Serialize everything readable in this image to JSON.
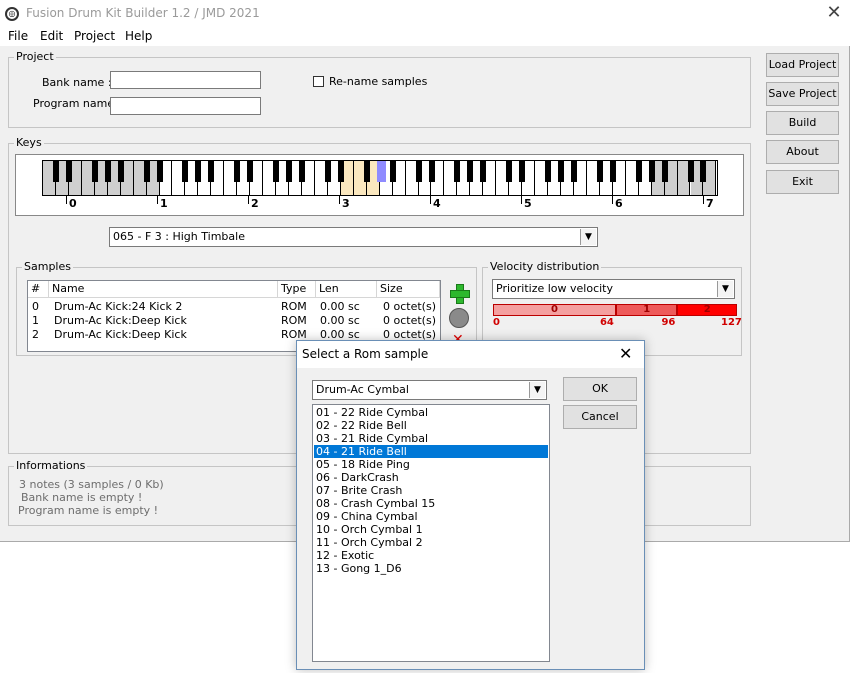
{
  "window": {
    "title": "Fusion Drum Kit Builder 1.2 / JMD 2021",
    "close_glyph": "✕"
  },
  "menu": [
    "File",
    "Edit",
    "Project",
    "Help"
  ],
  "project": {
    "legend": "Project",
    "bank_label": "Bank name :",
    "bank_value": "",
    "program_label": "Program name",
    "program_value": "",
    "rename_label": "Re-name samples",
    "rename_checked": false
  },
  "buttons": {
    "load": "Load Project",
    "save": "Save Project",
    "build": "Build",
    "about": "About",
    "exit": "Exit"
  },
  "keys": {
    "legend": "Keys",
    "octaves": [
      "0",
      "1",
      "2",
      "3",
      "4",
      "5",
      "6",
      "7"
    ],
    "selected_note": "065 - F 3  : High Timbale"
  },
  "samples": {
    "legend": "Samples",
    "columns": [
      "#",
      "Name",
      "Type",
      "Len",
      "Size"
    ],
    "rows": [
      {
        "idx": "0",
        "name": "Drum-Ac Kick:24 Kick 2",
        "type": "ROM",
        "len": "0.00 sc",
        "size": "0 octet(s)"
      },
      {
        "idx": "1",
        "name": "Drum-Ac Kick:Deep Kick",
        "type": "ROM",
        "len": "0.00 sc",
        "size": "0 octet(s)"
      },
      {
        "idx": "2",
        "name": "Drum-Ac Kick:Deep Kick",
        "type": "ROM",
        "len": "0.00 sc",
        "size": "0 octet(s)"
      }
    ]
  },
  "velocity": {
    "legend": "Velocity distribution",
    "mode": "Prioritize low velocity",
    "segments": [
      "0",
      "1",
      "2"
    ],
    "ticks": [
      "0",
      "64",
      "96",
      "127"
    ],
    "colors": [
      "#f4a0a0",
      "#ee5a5a",
      "#ff0000"
    ]
  },
  "info": {
    "legend": "Informations",
    "lines": [
      "3 notes (3 samples / 0 Kb)",
      "Bank name is empty !",
      "Program name is empty !"
    ]
  },
  "dialog": {
    "title": "Select a Rom sample",
    "category": "Drum-Ac Cymbal",
    "ok": "OK",
    "cancel": "Cancel",
    "items": [
      "01 - 22 Ride Cymbal",
      "02 - 22 Ride Bell",
      "03 - 21 Ride Cymbal",
      "04 - 21 Ride Bell",
      "05 - 18 Ride Ping",
      "06 - DarkCrash",
      "07 - Brite Crash",
      "08 - Crash Cymbal 15",
      "09 - China Cymbal",
      "10 - Orch Cymbal 1",
      "11 - Orch Cymbal 2",
      "12 - Exotic",
      "13 - Gong 1_D6"
    ],
    "selected_index": 3
  }
}
